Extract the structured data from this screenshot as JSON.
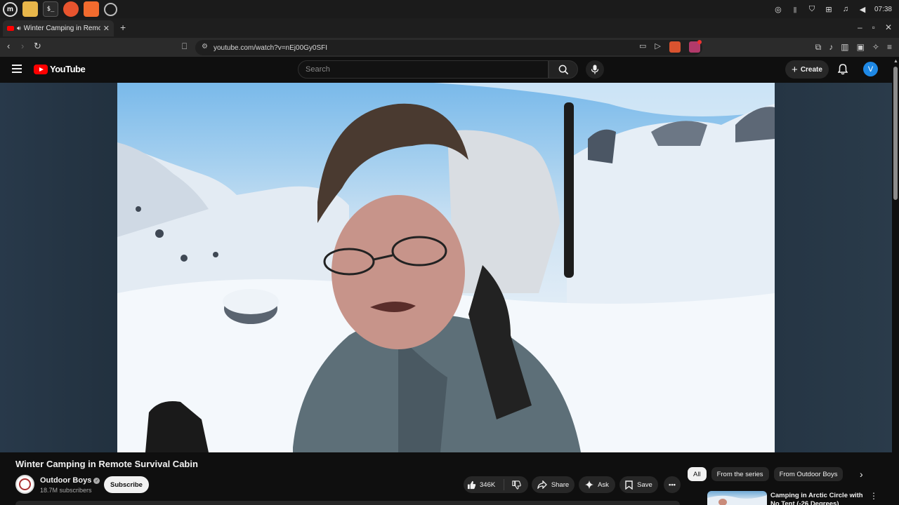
{
  "os_taskbar": {
    "apps": [
      "menu-icon",
      "files-icon",
      "terminal-icon",
      "firefox-icon",
      "brave-icon",
      "chrome-icon"
    ],
    "clock": "07:38"
  },
  "browser": {
    "tab_title": "Winter Camping in Remot",
    "url": "youtube.com/watch?v=nEj00Gy0SFI"
  },
  "youtube": {
    "logo_text": "YouTube",
    "search_placeholder": "Search",
    "create_label": "Create",
    "avatar_letter": "V"
  },
  "video": {
    "title": "Winter Camping in Remote Survival Cabin",
    "channel_name": "Outdoor Boys",
    "subscribers": "18.7M subscribers",
    "subscribe_label": "Subscribe",
    "like_count": "346K",
    "share_label": "Share",
    "ask_label": "Ask",
    "save_label": "Save"
  },
  "sidebar": {
    "chips": [
      "All",
      "From the series",
      "From Outdoor Boys"
    ],
    "active_chip": "All",
    "recommendation_title": "Camping in Arctic Circle with No Tent (-26 Degrees)"
  },
  "colors": {
    "background": "#0f0f0f",
    "brand_red": "#ff0000",
    "avatar_blue": "#1e88e5",
    "chip_bg": "#272727"
  }
}
